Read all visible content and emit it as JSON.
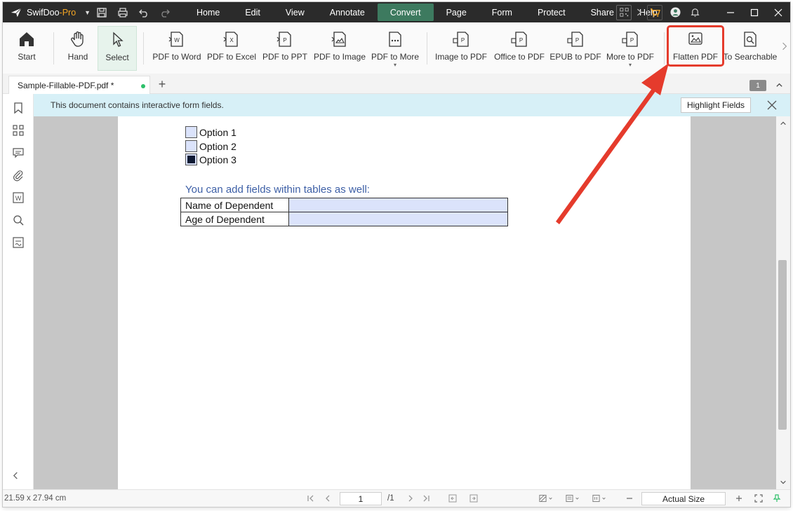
{
  "app": {
    "name": "SwifDoo",
    "edition": "-Pro"
  },
  "menu": [
    "Home",
    "Edit",
    "View",
    "Annotate",
    "Convert",
    "Page",
    "Form",
    "Protect",
    "Share",
    "Help"
  ],
  "active_menu": "Convert",
  "ribbon": {
    "start": "Start",
    "hand": "Hand",
    "select": "Select",
    "pdf_to_word": "PDF to Word",
    "pdf_to_excel": "PDF to Excel",
    "pdf_to_ppt": "PDF to PPT",
    "pdf_to_image": "PDF to Image",
    "pdf_to_more": "PDF to More",
    "image_to_pdf": "Image to PDF",
    "office_to_pdf": "Office to PDF",
    "epub_to_pdf": "EPUB to PDF",
    "more_to_pdf": "More to PDF",
    "flatten_pdf": "Flatten PDF",
    "to_searchable": "To Searchable"
  },
  "tabs": {
    "document": "Sample-Fillable-PDF.pdf *",
    "page_badge": "1"
  },
  "notification": {
    "text": "This document contains interactive form fields.",
    "button": "Highlight Fields"
  },
  "document": {
    "options": [
      {
        "label": "Option 1",
        "checked": false
      },
      {
        "label": "Option 2",
        "checked": false
      },
      {
        "label": "Option 3",
        "checked": true
      }
    ],
    "table_title": "You can add  fields within tables as well:",
    "table_rows": [
      {
        "label": "Name of Dependent",
        "value": ""
      },
      {
        "label": "Age of Dependent",
        "value": ""
      }
    ]
  },
  "status": {
    "dimensions": "21.59 x 27.94 cm",
    "current_page": "1",
    "total_pages": "/1",
    "zoom": "Actual Size"
  },
  "colors": {
    "titlebar": "#2b2b2b",
    "active_menu": "#3d7a5f",
    "brand_orange": "#f5a623",
    "callout_red": "#e53b2c",
    "notification_bg": "#d7f0f7",
    "form_field": "#dbe3fb"
  }
}
